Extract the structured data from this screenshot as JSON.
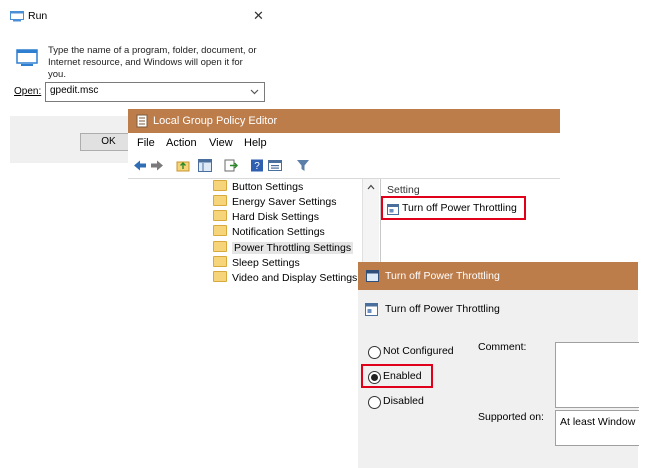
{
  "run_dialog": {
    "title": "Run",
    "close_glyph": "✕",
    "description": "Type the name of a program, folder, document, or Internet resource, and Windows will open it for you.",
    "open_label": "Open:",
    "command_value": "gpedit.msc",
    "ok_label": "OK",
    "icons": [
      "run-app-icon",
      "run-big-icon",
      "chevron-down-icon"
    ]
  },
  "gpe": {
    "title": "Local Group Policy Editor",
    "menu": [
      "File",
      "Action",
      "View",
      "Help"
    ],
    "toolbar_icons": [
      "back-arrow-icon",
      "forward-arrow-icon",
      "up-folder-icon",
      "show-hide-tree-icon",
      "export-list-icon",
      "help-icon",
      "properties-icon",
      "filter-icon"
    ],
    "tree_items": [
      "Button Settings",
      "Energy Saver Settings",
      "Hard Disk Settings",
      "Notification Settings",
      "Power Throttling Settings",
      "Sleep Settings",
      "Video and Display Settings"
    ],
    "selected_tree_item": "Power Throttling Settings",
    "column_header": "Setting",
    "setting_row": "Turn off Power Throttling",
    "highlight_color": "#e0001a",
    "title_color": "#bd7d4b"
  },
  "setting_dialog": {
    "title": "Turn off Power Throttling",
    "heading": "Turn off Power Throttling",
    "options": [
      "Not Configured",
      "Enabled",
      "Disabled"
    ],
    "selected_option": "Enabled",
    "comment_label": "Comment:",
    "supported_label": "Supported on:",
    "supported_value": "At least Window"
  }
}
